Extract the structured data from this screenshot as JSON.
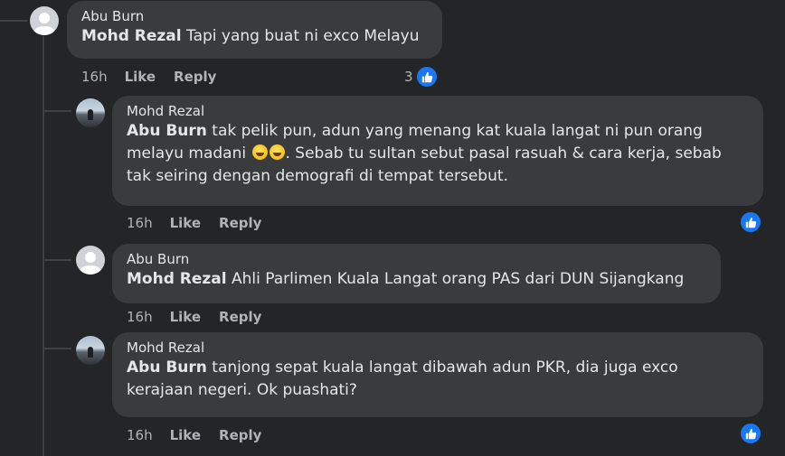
{
  "comments": [
    {
      "author": "Abu Burn",
      "mention": "Mohd Rezal",
      "body": " Tapi yang buat ni exco Melayu",
      "time": "16h",
      "like": "Like",
      "reply": "Reply",
      "reaction_count": "3",
      "reaction": "like-reaction-icon"
    },
    {
      "author": "Mohd Rezal",
      "mention": "Abu Burn",
      "body_line1": " tak pelik pun, adun yang menang kat kuala langat ni pun orang",
      "body_line2a": "melayu madani ",
      "body_line2b": ". Sebab tu sultan sebut pasal rasuah & cara kerja, sebab",
      "body_line3": "tak seiring dengan demografi di tempat tersebut.",
      "emoji": "rofl-emoji",
      "time": "16h",
      "like": "Like",
      "reply": "Reply",
      "reaction": "like-reaction-icon"
    },
    {
      "author": "Abu Burn",
      "mention": "Mohd Rezal",
      "body": " Ahli Parlimen Kuala Langat orang PAS dari DUN Sijangkang",
      "time": "16h",
      "like": "Like",
      "reply": "Reply"
    },
    {
      "author": "Mohd Rezal",
      "mention": "Abu Burn",
      "body_line1": " tanjong sepat kuala langat dibawah adun PKR, dia juga exco",
      "body_line2": "kerajaan negeri. Ok puashati?",
      "time": "16h",
      "like": "Like",
      "reply": "Reply",
      "reaction": "like-reaction-icon"
    }
  ],
  "colors": {
    "background": "#242526",
    "bubble": "#3a3b3c",
    "text": "#e4e6eb",
    "muted": "#b0b3b8",
    "accent": "#1877f2"
  }
}
